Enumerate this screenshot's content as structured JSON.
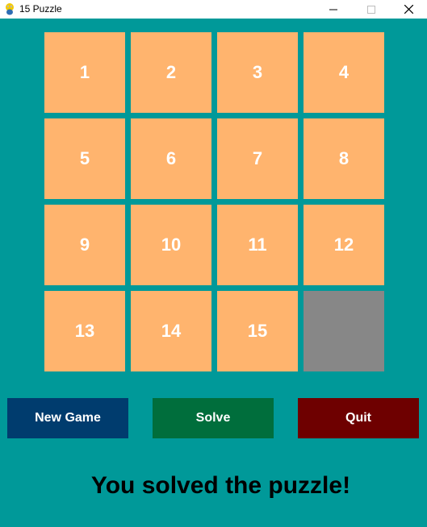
{
  "window": {
    "title": "15 Puzzle",
    "icon": "pygame-snake-icon",
    "controls": {
      "minimize": "minimize-icon",
      "maximize": "maximize-icon",
      "close": "close-icon"
    }
  },
  "colors": {
    "background": "#009999",
    "tile": "#ffb46e",
    "empty_tile": "#878787",
    "tile_text": "#ffffff",
    "new_game": "#003c6e",
    "solve": "#006e3c",
    "quit": "#6e0000",
    "message": "#000000"
  },
  "board": {
    "size": 4,
    "tiles": [
      [
        "1",
        "2",
        "3",
        "4"
      ],
      [
        "5",
        "6",
        "7",
        "8"
      ],
      [
        "9",
        "10",
        "11",
        "12"
      ],
      [
        "13",
        "14",
        "15",
        ""
      ]
    ]
  },
  "buttons": {
    "new_game": "New Game",
    "solve": "Solve",
    "quit": "Quit"
  },
  "status": {
    "message": "You solved the puzzle!"
  }
}
